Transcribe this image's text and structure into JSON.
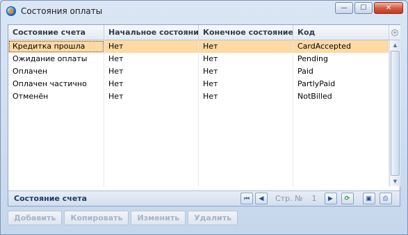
{
  "window": {
    "title": "Состояния оплаты",
    "minimize_glyph": "—",
    "maximize_glyph": "☐",
    "close_glyph": "✕"
  },
  "grid": {
    "columns": [
      "Состояние счета",
      "Начальное состояние",
      "Конечное состояние",
      "Код"
    ],
    "rows": [
      [
        "Кредитка прошла",
        "Нет",
        "Нет",
        "CardAccepted"
      ],
      [
        "Ожидание оплаты",
        "Нет",
        "Нет",
        "Pending"
      ],
      [
        "Оплачен",
        "Нет",
        "Нет",
        "Paid"
      ],
      [
        "Оплачен частично",
        "Нет",
        "Нет",
        "PartlyPaid"
      ],
      [
        "Отменён",
        "Нет",
        "Нет",
        "NotBilled"
      ]
    ],
    "selected_row": 0,
    "corner_glyph": "+",
    "scroll_up_glyph": "▲",
    "scroll_down_glyph": "▼"
  },
  "footer": {
    "title": "Состояние счета",
    "page_label": "Стр. №",
    "page_number": "1",
    "first_glyph": "⏮",
    "prev_glyph": "◀",
    "next_glyph": "▶",
    "refresh_glyph": "⟳",
    "save_glyph": "▣",
    "print_glyph": "⎙"
  },
  "actions": {
    "add": "Добавить",
    "copy": "Копировать",
    "edit": "Изменить",
    "delete": "Удалить"
  },
  "colors": {
    "selected_row": "#fdd9a3",
    "accent": "#1f3a67"
  }
}
